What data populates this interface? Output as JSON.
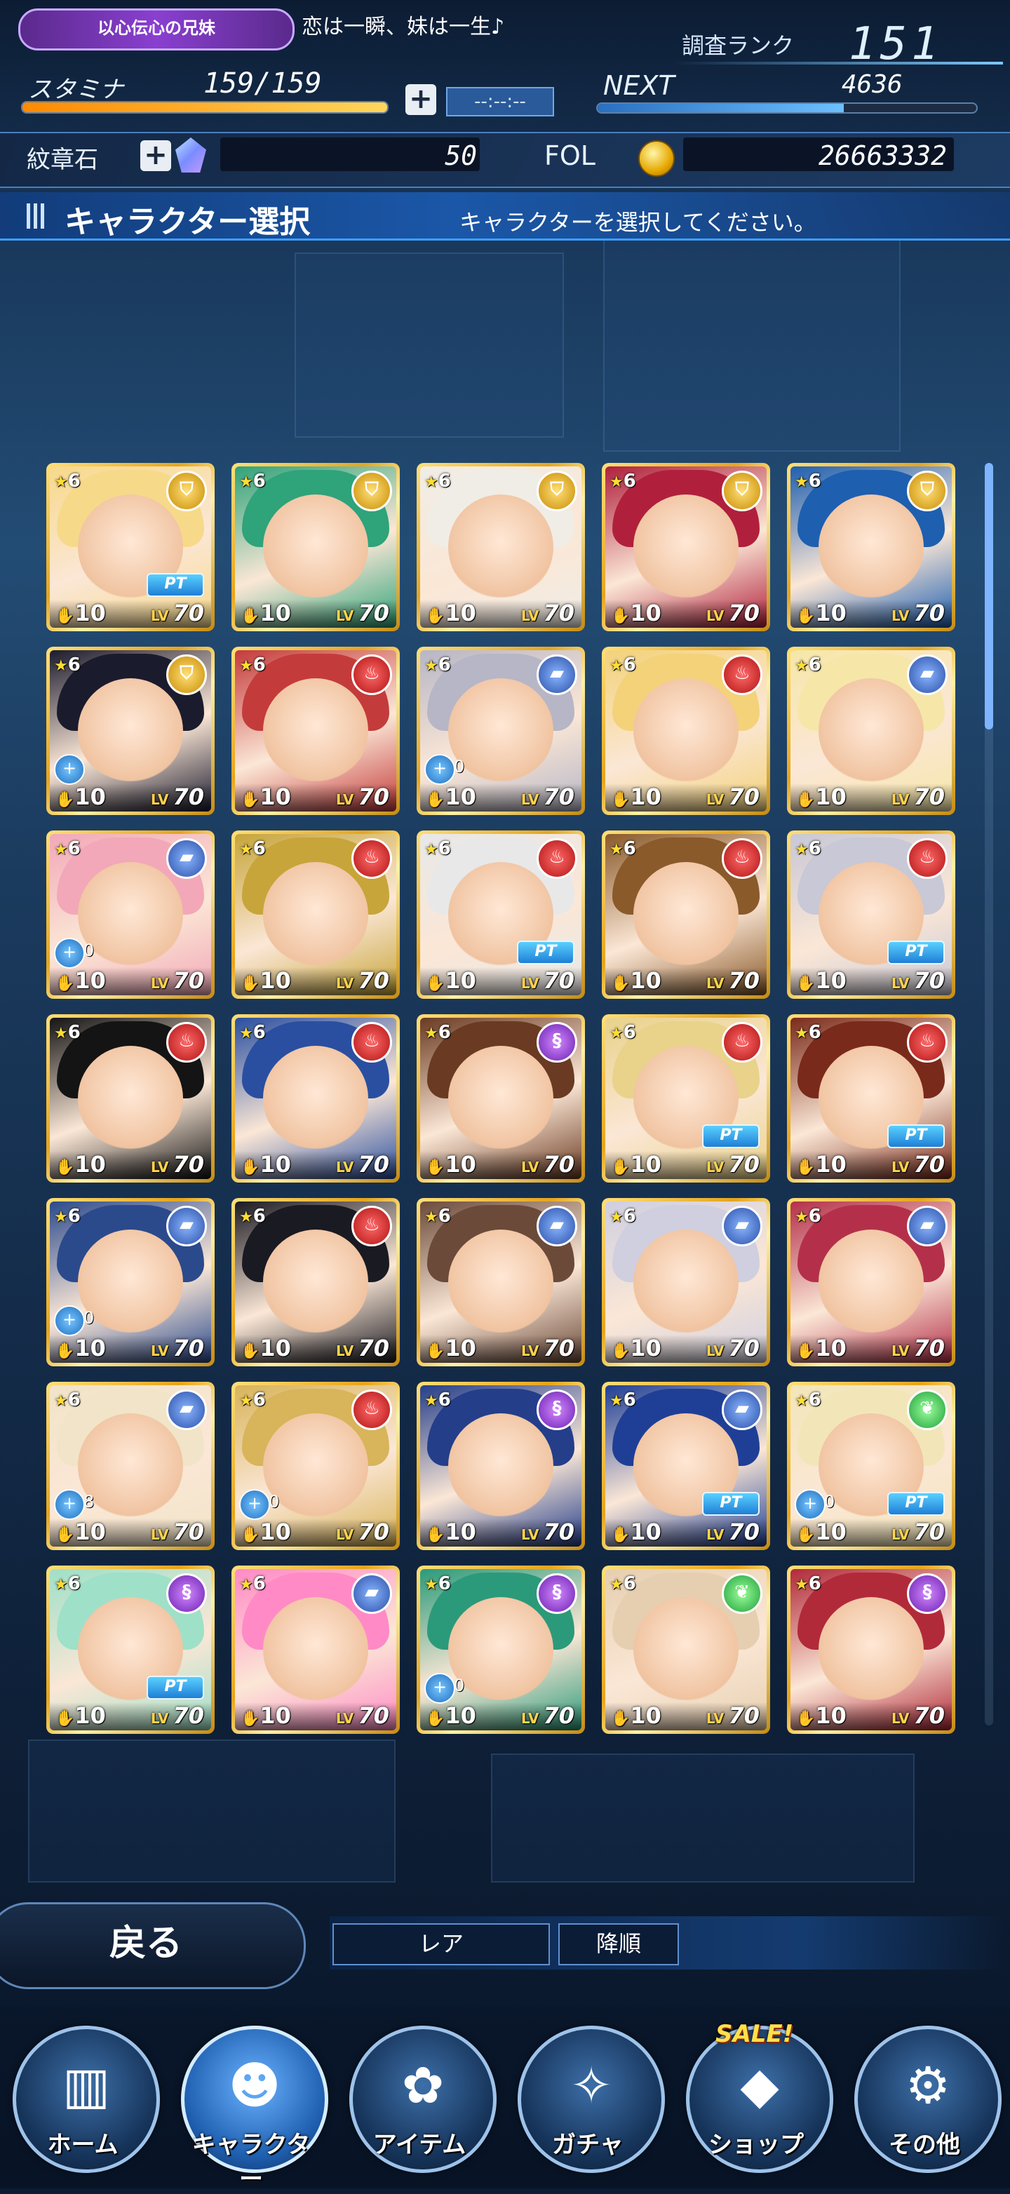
{
  "header": {
    "title_badge": "以心伝心の兄妹",
    "title_text": "恋は一瞬、妹は一生♪",
    "rank_label": "調査ランク",
    "rank_value": "151",
    "stamina_label": "スタミナ",
    "stamina_value": "159/159",
    "stamina_fraction": 1.0,
    "timer": "--:--:--",
    "next_label": "NEXT",
    "next_value": "4636",
    "gem_label": "紋章石",
    "gem_value": "50",
    "fol_label": "FOL",
    "fol_value": "26663332"
  },
  "selection": {
    "title": "キャラクター選択",
    "subtitle": "キャラクターを選択してください。"
  },
  "cards": [
    {
      "stars": "6",
      "elem": "gold",
      "pt": "PT",
      "plus": "",
      "level": "10",
      "lv": "70",
      "hair": "#f7d98a"
    },
    {
      "stars": "6",
      "elem": "gold",
      "pt": "",
      "plus": "",
      "level": "10",
      "lv": "70",
      "hair": "#2fa37a"
    },
    {
      "stars": "6",
      "elem": "gold",
      "pt": "",
      "plus": "",
      "level": "10",
      "lv": "70",
      "hair": "#f0ede6"
    },
    {
      "stars": "6",
      "elem": "gold",
      "pt": "",
      "plus": "",
      "level": "10",
      "lv": "70",
      "hair": "#b0203c"
    },
    {
      "stars": "6",
      "elem": "gold",
      "pt": "",
      "plus": "",
      "level": "10",
      "lv": "70",
      "hair": "#1e5fb0"
    },
    {
      "stars": "6",
      "elem": "gold",
      "pt": "",
      "plus": "+",
      "plusn": "",
      "level": "10",
      "lv": "70",
      "hair": "#1b1b2e"
    },
    {
      "stars": "6",
      "elem": "red",
      "pt": "",
      "plus": "",
      "level": "10",
      "lv": "70",
      "hair": "#c43b3b"
    },
    {
      "stars": "6",
      "elem": "blue",
      "pt": "",
      "plus": "+",
      "plusn": "0",
      "level": "10",
      "lv": "70",
      "hair": "#b6b6c6"
    },
    {
      "stars": "6",
      "elem": "red",
      "pt": "",
      "plus": "",
      "level": "10",
      "lv": "70",
      "hair": "#f3d27a"
    },
    {
      "stars": "6",
      "elem": "blue",
      "pt": "",
      "plus": "",
      "level": "10",
      "lv": "70",
      "hair": "#f6e7a8"
    },
    {
      "stars": "6",
      "elem": "blue",
      "pt": "",
      "plus": "+",
      "plusn": "0",
      "level": "10",
      "lv": "70",
      "hair": "#f2a8b8"
    },
    {
      "stars": "6",
      "elem": "red",
      "pt": "",
      "plus": "",
      "level": "10",
      "lv": "70",
      "hair": "#c7a53a"
    },
    {
      "stars": "6",
      "elem": "red",
      "pt": "PT",
      "plus": "",
      "level": "10",
      "lv": "70",
      "hair": "#e8e8e8"
    },
    {
      "stars": "6",
      "elem": "red",
      "pt": "",
      "plus": "",
      "level": "10",
      "lv": "70",
      "hair": "#8a5a2b"
    },
    {
      "stars": "6",
      "elem": "red",
      "pt": "PT",
      "plus": "",
      "level": "10",
      "lv": "70",
      "hair": "#c8c8d6"
    },
    {
      "stars": "6",
      "elem": "red",
      "pt": "",
      "plus": "",
      "level": "10",
      "lv": "70",
      "hair": "#141414"
    },
    {
      "stars": "6",
      "elem": "red",
      "pt": "",
      "plus": "",
      "level": "10",
      "lv": "70",
      "hair": "#2a4fa0"
    },
    {
      "stars": "6",
      "elem": "purple",
      "pt": "",
      "plus": "",
      "level": "10",
      "lv": "70",
      "hair": "#6a3a22"
    },
    {
      "stars": "6",
      "elem": "red",
      "pt": "PT",
      "plus": "",
      "level": "10",
      "lv": "70",
      "hair": "#e9d28a"
    },
    {
      "stars": "6",
      "elem": "red",
      "pt": "PT",
      "plus": "",
      "level": "10",
      "lv": "70",
      "hair": "#7a2a1a"
    },
    {
      "stars": "6",
      "elem": "blue",
      "pt": "",
      "plus": "+",
      "plusn": "0",
      "level": "10",
      "lv": "70",
      "hair": "#2b4a8c"
    },
    {
      "stars": "6",
      "elem": "red",
      "pt": "",
      "plus": "",
      "level": "10",
      "lv": "70",
      "hair": "#1a1a22"
    },
    {
      "stars": "6",
      "elem": "blue",
      "pt": "",
      "plus": "",
      "level": "10",
      "lv": "70",
      "hair": "#6b4a3a"
    },
    {
      "stars": "6",
      "elem": "blue",
      "pt": "",
      "plus": "",
      "level": "10",
      "lv": "70",
      "hair": "#cfcfe0"
    },
    {
      "stars": "6",
      "elem": "blue",
      "pt": "",
      "plus": "",
      "level": "10",
      "lv": "70",
      "hair": "#b4304a"
    },
    {
      "stars": "6",
      "elem": "blue",
      "pt": "",
      "plus": "+",
      "plusn": "8",
      "level": "10",
      "lv": "70",
      "hair": "#f1e4c8"
    },
    {
      "stars": "6",
      "elem": "red",
      "pt": "",
      "plus": "+",
      "plusn": "0",
      "level": "10",
      "lv": "70",
      "hair": "#d8b45a"
    },
    {
      "stars": "6",
      "elem": "purple",
      "pt": "",
      "plus": "",
      "level": "10",
      "lv": "70",
      "hair": "#243e8a"
    },
    {
      "stars": "6",
      "elem": "blue",
      "pt": "PT",
      "plus": "",
      "level": "10",
      "lv": "70",
      "hair": "#1f3f96"
    },
    {
      "stars": "6",
      "elem": "green",
      "pt": "PT",
      "plus": "+",
      "plusn": "0",
      "level": "10",
      "lv": "70",
      "hair": "#f2e6b8"
    },
    {
      "stars": "6",
      "elem": "purple",
      "pt": "PT",
      "plus": "",
      "level": "10",
      "lv": "70",
      "hair": "#9fe0c8"
    },
    {
      "stars": "6",
      "elem": "blue",
      "pt": "",
      "plus": "",
      "level": "10",
      "lv": "70",
      "hair": "#ff8ac6"
    },
    {
      "stars": "6",
      "elem": "purple",
      "pt": "",
      "plus": "+",
      "plusn": "0",
      "level": "10",
      "lv": "70",
      "hair": "#2b9a7a"
    },
    {
      "stars": "6",
      "elem": "green",
      "pt": "",
      "plus": "",
      "level": "10",
      "lv": "70",
      "hair": "#e6cfb0"
    },
    {
      "stars": "6",
      "elem": "purple",
      "pt": "",
      "plus": "",
      "level": "10",
      "lv": "70",
      "hair": "#b12a3a"
    }
  ],
  "controls": {
    "back": "戻る",
    "sort_type": "レア",
    "sort_order": "降順"
  },
  "nav": [
    {
      "label": "ホーム",
      "icon": "home-door-icon",
      "glyph": "▥"
    },
    {
      "label": "キャラクター",
      "icon": "character-group-icon",
      "glyph": "☻"
    },
    {
      "label": "アイテム",
      "icon": "item-chest-icon",
      "glyph": "✿"
    },
    {
      "label": "ガチャ",
      "icon": "gacha-character-icon",
      "glyph": "✧"
    },
    {
      "label": "ショップ",
      "icon": "shop-crystal-icon",
      "glyph": "◆"
    },
    {
      "label": "その他",
      "icon": "gear-icon",
      "glyph": "⚙"
    }
  ],
  "sale": "SALE!"
}
